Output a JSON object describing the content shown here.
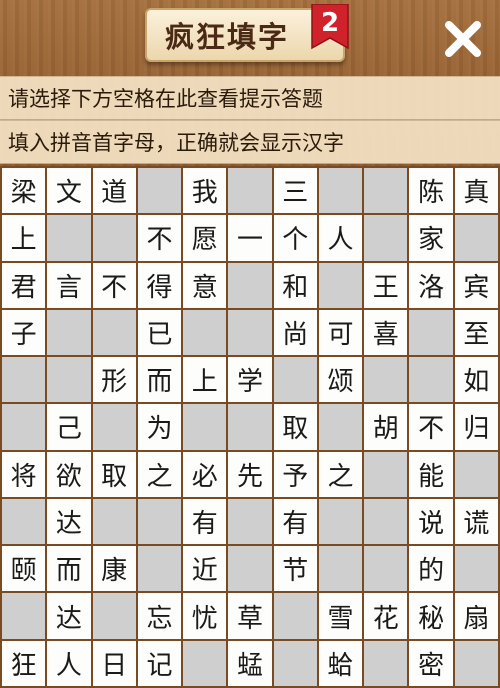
{
  "header": {
    "title": "疯狂填字",
    "level": "2",
    "close_icon": "close-x-icon"
  },
  "hints": [
    "请选择下方空格在此查看提示答题",
    "填入拼音首字母，正确就会显示汉字"
  ],
  "colors": {
    "white_cell": "#fdfdfb",
    "blank_cell": "#cfcfcf",
    "grid_line": "#7a4a22",
    "badge_red": "#d0222a"
  },
  "grid": {
    "rows": [
      [
        "梁",
        "文",
        "道",
        "#",
        "我",
        "#",
        "三",
        "#",
        "#",
        "陈",
        "真"
      ],
      [
        "上",
        "#",
        "#",
        "不",
        "愿",
        "一",
        "个",
        "人",
        "#",
        "家",
        "#"
      ],
      [
        "君",
        "言",
        "不",
        "得",
        "意",
        "#",
        "和",
        "#",
        "王",
        "洛",
        "宾"
      ],
      [
        "子",
        "#",
        "#",
        "已",
        "#",
        "#",
        "尚",
        "可",
        "喜",
        "#",
        "至"
      ],
      [
        "#",
        "#",
        "形",
        "而",
        "上",
        "学",
        "#",
        "颂",
        "#",
        "#",
        "如"
      ],
      [
        "#",
        "己",
        "#",
        "为",
        "#",
        "#",
        "取",
        "#",
        "胡",
        "不",
        "归"
      ],
      [
        "将",
        "欲",
        "取",
        "之",
        "必",
        "先",
        "予",
        "之",
        "#",
        "能",
        "#"
      ],
      [
        "#",
        "达",
        "#",
        "#",
        "有",
        "#",
        "有",
        "#",
        "#",
        "说",
        "谎"
      ],
      [
        "颐",
        "而",
        "康",
        "#",
        "近",
        "#",
        "节",
        "#",
        "#",
        "的",
        "#"
      ],
      [
        "#",
        "达",
        "#",
        "忘",
        "忧",
        "草",
        "#",
        "雪",
        "花",
        "秘",
        "扇"
      ],
      [
        "狂",
        "人",
        "日",
        "记",
        "#",
        "蜢",
        "#",
        "蛤",
        "#",
        "密",
        "#"
      ]
    ]
  }
}
